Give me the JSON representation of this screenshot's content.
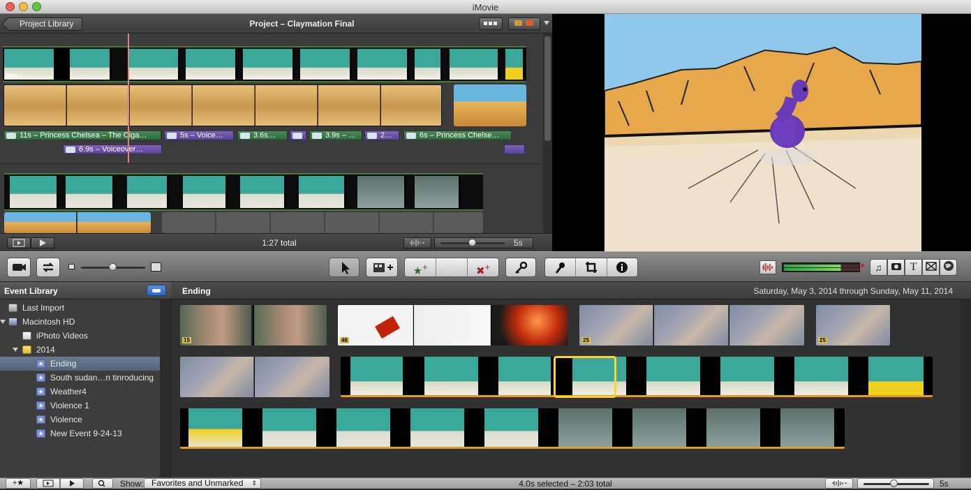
{
  "window": {
    "title": "iMovie"
  },
  "project": {
    "back_label": "Project Library",
    "title": "Project – Claymation Final",
    "duration_badge": "30s",
    "total": "1:27 total",
    "zoom_value": "5s",
    "audio_clips": [
      {
        "label": "11s – Princess Chelsea – The Ciga…",
        "color": "green"
      },
      {
        "label": "5s – Voice…",
        "color": "purple"
      },
      {
        "label": "3.6s…",
        "color": "green"
      },
      {
        "label": "",
        "color": "purple"
      },
      {
        "label": "3.9s – …",
        "color": "green"
      },
      {
        "label": "2…",
        "color": "purple"
      },
      {
        "label": "6s – Princess Chelse…",
        "color": "green"
      },
      {
        "label": "6.9s – Voiceover…",
        "color": "purple"
      }
    ]
  },
  "event_library": {
    "title": "Event Library",
    "items": [
      {
        "label": "Last Import",
        "icon": "last-import-icon",
        "level": 1
      },
      {
        "label": "Macintosh HD",
        "icon": "hard-drive-icon",
        "level": 0
      },
      {
        "label": "iPhoto Videos",
        "icon": "iphoto-icon",
        "level": 2
      },
      {
        "label": "2014",
        "icon": "folder-icon",
        "level": 1
      },
      {
        "label": "Ending",
        "icon": "event-star-icon",
        "level": 3,
        "selected": true
      },
      {
        "label": "South sudan…n tinroducing",
        "icon": "event-star-icon",
        "level": 3
      },
      {
        "label": "Weather4",
        "icon": "event-star-icon",
        "level": 3
      },
      {
        "label": "Violence 1",
        "icon": "event-star-icon",
        "level": 3
      },
      {
        "label": "Violence",
        "icon": "event-star-icon",
        "level": 3
      },
      {
        "label": "New Event 9-24-13",
        "icon": "event-star-icon",
        "level": 3
      }
    ]
  },
  "event": {
    "name": "Ending",
    "dates": "Saturday, May 3, 2014 through Sunday, May 11, 2014",
    "clip_counts": [
      "15",
      "46",
      "25",
      "25"
    ]
  },
  "bottom": {
    "show_label": "Show:",
    "show_value": "Favorites and Unmarked",
    "status": "4.0s selected – 2:03 total",
    "zoom_value": "5s"
  },
  "colors": {
    "accent": "#ffd12a",
    "green_audio": "#4d8a58",
    "purple_audio": "#7d62b8",
    "playhead": "#e4807a"
  }
}
